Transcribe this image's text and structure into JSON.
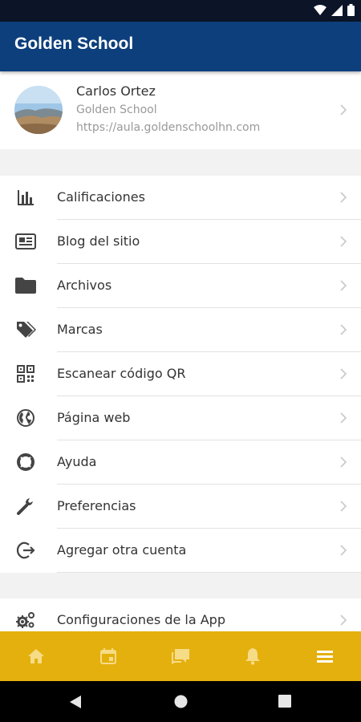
{
  "app": {
    "title": "Golden School"
  },
  "profile": {
    "name": "Carlos Ortez",
    "school": "Golden School",
    "url": "https://aula.goldenschoolhn.com"
  },
  "menu": [
    {
      "label": "Calificaciones",
      "icon": "bar-chart-icon"
    },
    {
      "label": "Blog del sitio",
      "icon": "newspaper-icon"
    },
    {
      "label": "Archivos",
      "icon": "folder-icon"
    },
    {
      "label": "Marcas",
      "icon": "tags-icon"
    },
    {
      "label": "Escanear código QR",
      "icon": "qr-code-icon"
    },
    {
      "label": "Página web",
      "icon": "globe-icon"
    },
    {
      "label": "Ayuda",
      "icon": "lifebuoy-icon"
    },
    {
      "label": "Preferencias",
      "icon": "wrench-icon"
    },
    {
      "label": "Agregar otra cuenta",
      "icon": "sign-in-icon"
    }
  ],
  "menu2": [
    {
      "label": "Configuraciones de la App",
      "icon": "gears-icon"
    }
  ],
  "bottom_nav": [
    "home-icon",
    "calendar-icon",
    "messages-icon",
    "bell-icon",
    "menu-icon"
  ],
  "colors": {
    "app_bar": "#0d3f7c",
    "bottom_nav": "#e4b00e",
    "status_bar": "#0b1527"
  }
}
